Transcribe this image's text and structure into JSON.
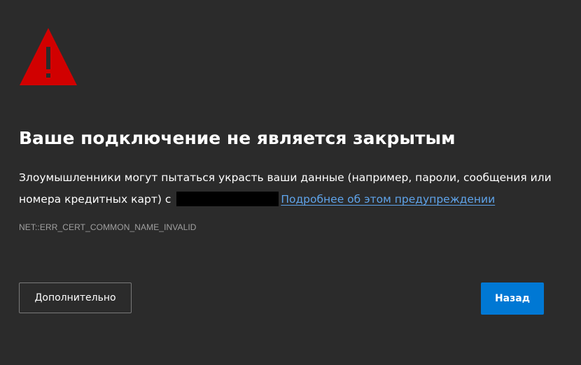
{
  "icon": {
    "name": "warning-triangle-icon",
    "color": "#d10000",
    "glyph_color": "#2b2b2b"
  },
  "title": "Ваше подключение не является закрытым",
  "description": {
    "text_before": "Злоумышленники могут пытаться украсть ваши данные (например, пароли, сообщения или номера кредитных карт) с",
    "redacted_host_color": "#000000",
    "link_label": "Подробнее об этом предупреждении"
  },
  "error_code": "NET::ERR_CERT_COMMON_NAME_INVALID",
  "buttons": {
    "advanced_label": "Дополнительно",
    "back_label": "Назад"
  },
  "colors": {
    "background": "#2b2b2b",
    "text": "#ffffff",
    "link": "#5fa4eb",
    "muted": "#a0a0a0",
    "accent": "#0078d4"
  }
}
